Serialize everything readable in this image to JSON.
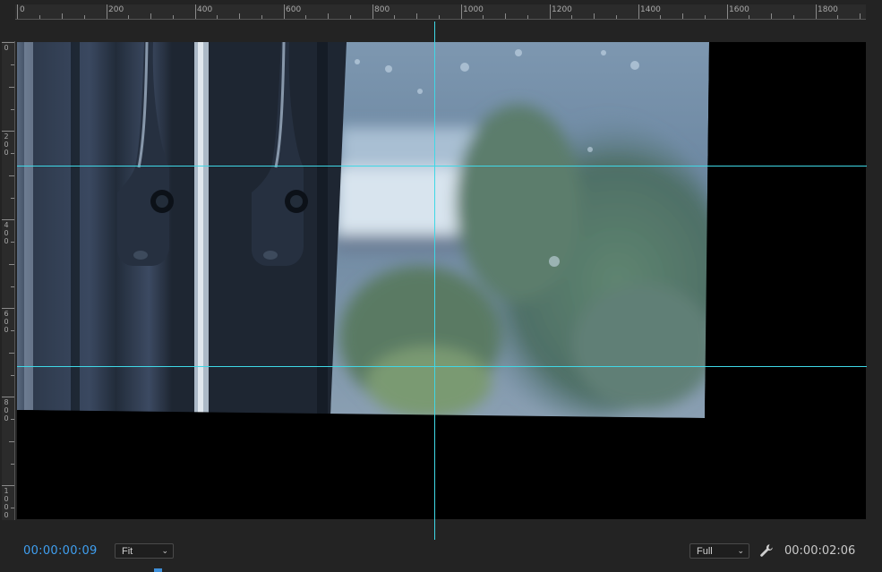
{
  "ruler_top": {
    "labels": [
      "0",
      "200",
      "400",
      "600",
      "800",
      "1000",
      "1200",
      "1400",
      "1600",
      "1800"
    ]
  },
  "ruler_left": {
    "labels": [
      "0",
      "200",
      "400",
      "600",
      "800",
      "1000"
    ]
  },
  "monitor": {
    "current_timecode": "00:00:00:09",
    "duration_timecode": "00:00:02:06",
    "zoom_select": {
      "value": "Fit"
    },
    "quality_select": {
      "value": "Full"
    }
  },
  "colors": {
    "guide": "#3fd8e6",
    "timecode_accent": "#3f9ff0",
    "panel_bg": "#232323"
  },
  "icons": {
    "settings": "wrench-icon",
    "dropdown": "chevron-down-icon"
  }
}
